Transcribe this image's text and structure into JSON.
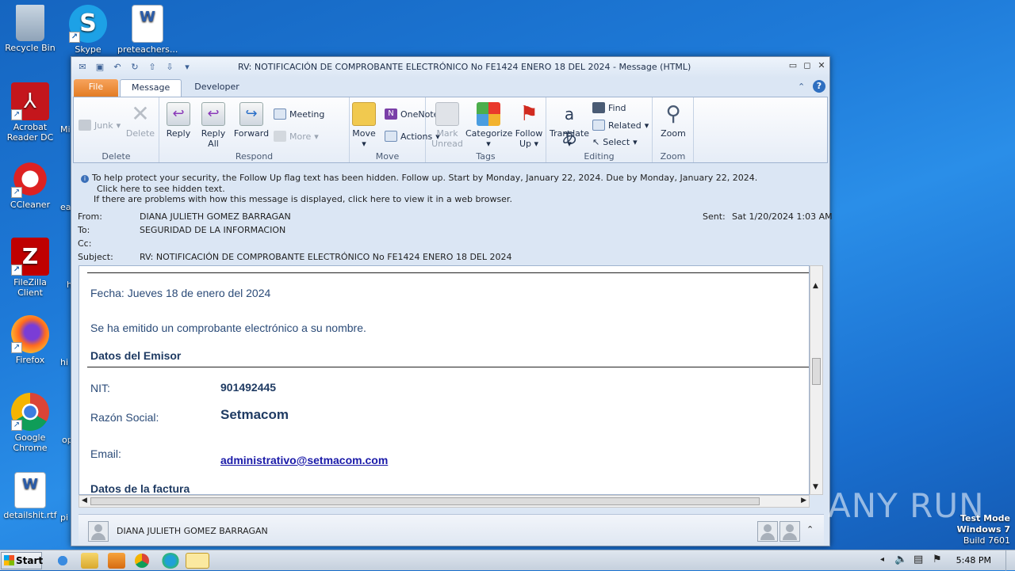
{
  "desktop": {
    "icons": [
      {
        "label": "Recycle Bin"
      },
      {
        "label": "Skype"
      },
      {
        "label": "preteachers..."
      },
      {
        "label": "Acrobat Reader DC"
      },
      {
        "label": "CCleaner"
      },
      {
        "label": "FileZilla Client"
      },
      {
        "label": "Firefox"
      },
      {
        "label": "Google Chrome"
      },
      {
        "label": "detailshit.rtf"
      }
    ],
    "partial_labels": [
      "Mi",
      "ea",
      "h",
      "hi",
      "op",
      "pi"
    ]
  },
  "window": {
    "title": "RV: NOTIFICACIÓN DE COMPROBANTE ELECTRÓNICO No FE1424 ENERO 18 DEL 2024  -  Message (HTML)",
    "tabs": [
      "File",
      "Message",
      "Developer"
    ],
    "active_tab": "Message"
  },
  "ribbon": {
    "delete": {
      "label": "Delete",
      "junk": "Junk",
      "delete": "Delete"
    },
    "respond": {
      "label": "Respond",
      "reply": "Reply",
      "reply_all_1": "Reply",
      "reply_all_2": "All",
      "forward": "Forward",
      "meeting": "Meeting",
      "more": "More"
    },
    "move": {
      "label": "Move",
      "move": "Move",
      "onenote": "OneNote",
      "actions": "Actions"
    },
    "tags": {
      "label": "Tags",
      "mark_1": "Mark",
      "mark_2": "Unread",
      "categorize": "Categorize",
      "follow_1": "Follow",
      "follow_2": "Up"
    },
    "editing": {
      "label": "Editing",
      "translate": "Translate",
      "find": "Find",
      "related": "Related",
      "select": "Select"
    },
    "zoom": {
      "label": "Zoom",
      "zoom": "Zoom"
    }
  },
  "infobar": {
    "line1": "To help protect your security, the Follow Up flag text has been hidden. Follow up.  Start by Monday, January 22, 2024.  Due by Monday, January 22, 2024.",
    "line2": "Click here to see hidden text.",
    "line3": "If there are problems with how this message is displayed, click here to view it in a web browser."
  },
  "header": {
    "from_label": "From:",
    "from": "DIANA JULIETH GOMEZ BARRAGAN",
    "to_label": "To:",
    "to": "SEGURIDAD DE LA INFORMACION",
    "cc_label": "Cc:",
    "subject_label": "Subject:",
    "subject": "RV: NOTIFICACIÓN DE COMPROBANTE ELECTRÓNICO No FE1424 ENERO 18 DEL 2024",
    "sent_label": "Sent:",
    "sent": "Sat 1/20/2024 1:03 AM"
  },
  "message": {
    "fecha": "Fecha: Jueves 18 de enero del 2024",
    "intro": "Se ha emitido un comprobante electrónico a su nombre.",
    "emisor_title": "Datos del Emisor",
    "nit_label": "NIT:",
    "nit": "901492445",
    "razon_label": "Razón Social:",
    "razon": "Setmacom",
    "email_label": "Email:",
    "email": "administrativo@setmacom.com",
    "factura_title": "Datos de la factura"
  },
  "people_pane": {
    "name": "DIANA JULIETH GOMEZ BARRAGAN"
  },
  "taskbar": {
    "start": "Start",
    "clock": "5:48 PM"
  },
  "watermark": {
    "line1": "Test Mode",
    "line2": "Windows 7",
    "line3": "Build 7601",
    "anyrun": "ANY RUN"
  }
}
